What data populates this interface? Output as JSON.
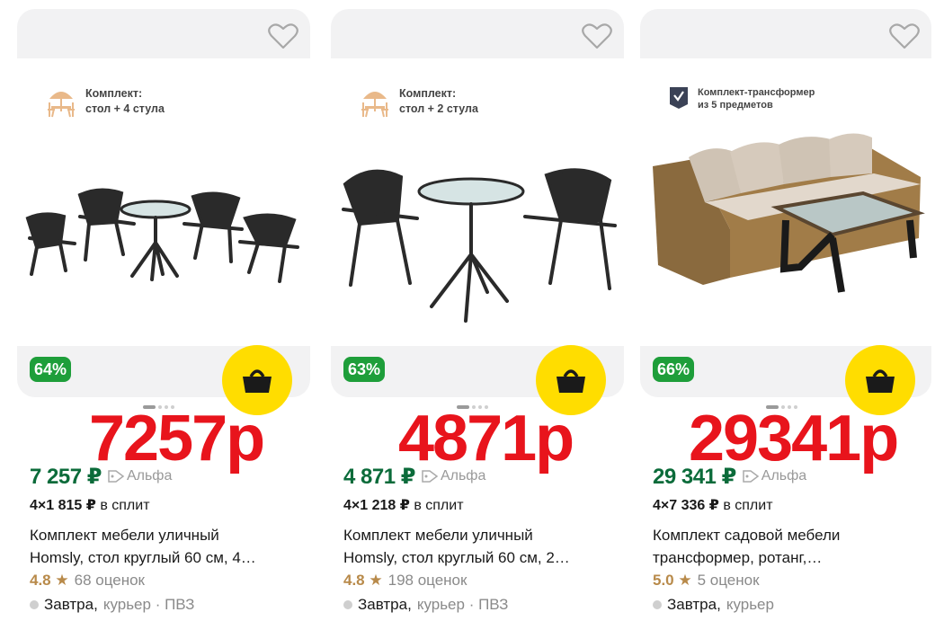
{
  "products": [
    {
      "promo": "Комплект:\nстол + 4 стула",
      "discount": "64%",
      "big_price": "7257р",
      "price": "7 257 ₽",
      "alfa": "Альфа",
      "split_amount": "4×1 815 ₽",
      "split_label": "в сплит",
      "title": "Комплект мебели уличный\nHomsly, стол круглый 60 см, 4…",
      "rating": "4.8",
      "reviews": "68 оценок",
      "delivery_day": "Завтра,",
      "delivery_method": "курьер · ПВЗ",
      "icons": {
        "favorite": "heart-icon",
        "cart": "basket-icon",
        "promo": "table-set-icon"
      }
    },
    {
      "promo": "Комплект:\nстол + 2 стула",
      "discount": "63%",
      "big_price": "4871р",
      "price": "4 871 ₽",
      "alfa": "Альфа",
      "split_amount": "4×1 218 ₽",
      "split_label": "в сплит",
      "title": "Комплект мебели уличный\nHomsly, стол круглый 60 см, 2…",
      "rating": "4.8",
      "reviews": "198 оценок",
      "delivery_day": "Завтра,",
      "delivery_method": "курьер · ПВЗ",
      "icons": {
        "favorite": "heart-icon",
        "cart": "basket-icon",
        "promo": "table-set-icon"
      }
    },
    {
      "promo": "Комплект-трансформер\nиз 5 предметов",
      "discount": "66%",
      "big_price": "29341р",
      "price": "29 341 ₽",
      "alfa": "Альфа",
      "split_amount": "4×7 336 ₽",
      "split_label": "в сплит",
      "title": "Комплект садовой мебели\nтрансформер, ротанг,…",
      "rating": "5.0",
      "reviews": "5 оценок",
      "delivery_day": "Завтра,",
      "delivery_method": "курьер",
      "icons": {
        "favorite": "heart-icon",
        "cart": "basket-icon",
        "promo": "checkmark-shield-icon"
      }
    }
  ],
  "colors": {
    "discount_badge": "#1e9e3a",
    "price_green": "#0b6b3a",
    "big_price_red": "#e8141c",
    "cart_yellow": "#ffdd00",
    "rating_gold": "#b88a4a"
  }
}
